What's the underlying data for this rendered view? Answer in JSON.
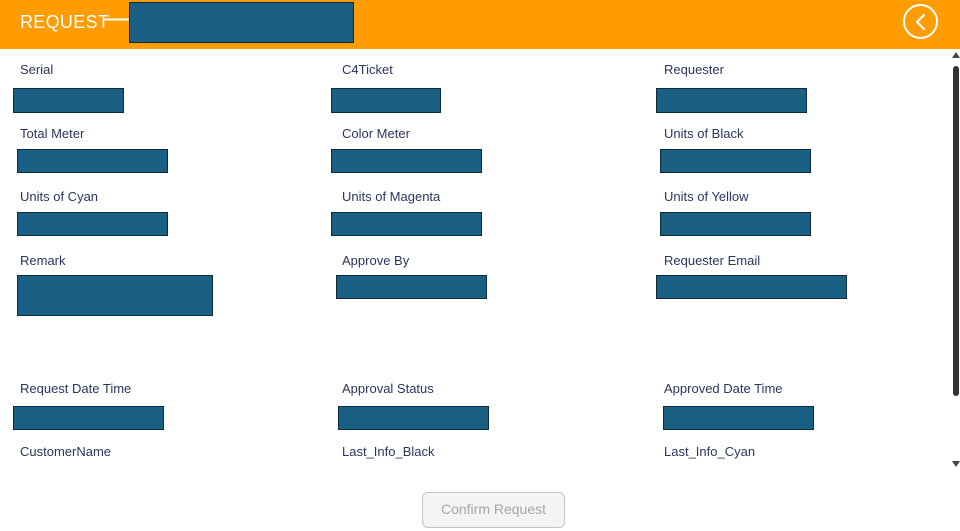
{
  "header": {
    "title": "REQUEST",
    "arrow": "⟶",
    "back_icon": "chevron-left-icon",
    "color": "#ff9c00"
  },
  "fields": {
    "serial": "Serial",
    "c4ticket": "C4Ticket",
    "requester": "Requester",
    "total_meter": "Total Meter",
    "color_meter": "Color Meter",
    "units_black": "Units of Black",
    "units_cyan": "Units of Cyan",
    "units_magenta": "Units of Magenta",
    "units_yellow": "Units of Yellow",
    "remark": "Remark",
    "approve_by": "Approve By",
    "requester_email": "Requester Email",
    "request_date_time": "Request Date Time",
    "approval_status": "Approval Status",
    "approved_date_time": "Approved Date Time",
    "customer_name": "CustomerName",
    "last_info_black": "Last_Info_Black",
    "last_info_cyan": "Last_Info_Cyan"
  },
  "footer": {
    "confirm_label": "Confirm Request"
  },
  "colors": {
    "redaction": "#1a6085",
    "label_text": "#2a3560"
  }
}
